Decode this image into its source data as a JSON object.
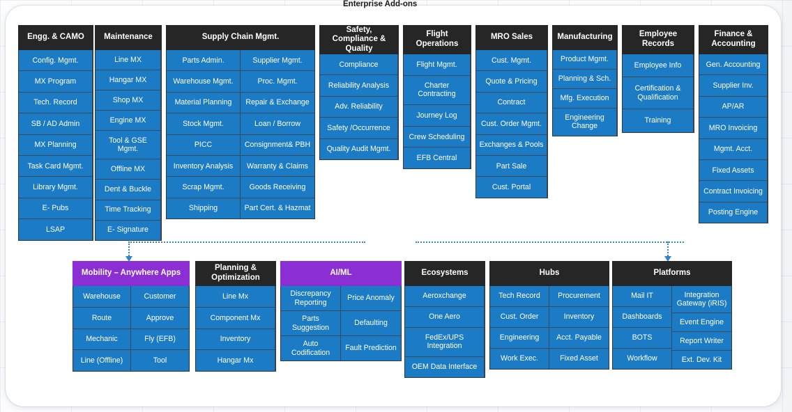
{
  "diagram": {
    "addons_label": "Enterprise Add-ons",
    "colors": {
      "tile_blue": "#1B7BC4",
      "header_dark": "#262626",
      "header_purple": "#8B2FD4",
      "connector_blue": "#2E86C8"
    }
  },
  "top_modules": [
    {
      "title": "Engg. & CAMO",
      "header_style": "dark",
      "columns": [
        [
          "Config. Mgmt.",
          "MX Program",
          "Tech. Record",
          "SB / AD Admin",
          "MX Planning",
          "Task Card Mgmt.",
          "Library Mgmt.",
          "E- Pubs",
          "LSAP"
        ]
      ]
    },
    {
      "title": "Maintenance",
      "header_style": "dark",
      "columns": [
        [
          "Line MX",
          "Hangar MX",
          "Shop MX",
          "Engine MX",
          "Tool & GSE Mgmt.",
          "Offline MX",
          "Dent & Buckle",
          "Time Tracking",
          "E- Signature"
        ]
      ]
    },
    {
      "title": "Supply Chain Mgmt.",
      "header_style": "dark",
      "columns": [
        [
          "Parts Admin.",
          "Warehouse Mgmt.",
          "Material Planning",
          "Stock Mgmt.",
          "PICC",
          "Inventory Analysis",
          "Scrap Mgmt.",
          "Shipping"
        ],
        [
          "Supplier Mgmt.",
          "Proc. Mgmt.",
          "Repair & Exchange",
          "Loan / Borrow",
          "Consignment& PBH",
          "Warranty & Claims",
          "Goods Receiving",
          "Part Cert. & Hazmat"
        ]
      ]
    },
    {
      "title": "Safety, Compliance & Quality",
      "header_style": "dark",
      "columns": [
        [
          "Compliance",
          "Reliability Analysis",
          "Adv. Reliability",
          "Safety /Occurrence",
          "Quality Audit Mgmt."
        ]
      ]
    },
    {
      "title": "Flight Operations",
      "header_style": "dark",
      "columns": [
        [
          "Flight Mgmt.",
          "Charter Contracting",
          "Journey Log",
          "Crew Scheduling",
          "EFB Central"
        ]
      ]
    },
    {
      "title": "MRO Sales",
      "header_style": "dark",
      "columns": [
        [
          "Cust. Mgmt.",
          "Quote & Pricing",
          "Contract",
          "Cust. Order Mgmt.",
          "Exchanges & Pools",
          "Part Sale",
          "Cust. Portal"
        ]
      ]
    },
    {
      "title": "Manufacturing",
      "header_style": "dark",
      "columns": [
        [
          "Product Mgmt.",
          "Planning & Sch.",
          "Mfg. Execution",
          "Engineering Change"
        ]
      ]
    },
    {
      "title": "Employee Records",
      "header_style": "dark",
      "columns": [
        [
          "Employee Info",
          "Certification & Qualification",
          "Training"
        ]
      ]
    },
    {
      "title": "Finance & Accounting",
      "header_style": "dark",
      "columns": [
        [
          "Gen. Accounting",
          "Supplier Inv.",
          "AP/AR",
          "MRO Invoicing",
          "Mgmt. Acct.",
          "Fixed Assets",
          "Contract Invoicing",
          "Posting Engine"
        ]
      ]
    }
  ],
  "addon_modules": [
    {
      "title": "Mobility – Anywhere Apps",
      "header_style": "purple",
      "columns": [
        [
          "Warehouse",
          "Route",
          "Mechanic",
          "Line (Offline)"
        ],
        [
          "Customer",
          "Approve",
          "Fly (EFB)",
          "Tool"
        ]
      ]
    },
    {
      "title": "Planning & Optimization",
      "header_style": "dark",
      "columns": [
        [
          "Line Mx",
          "Component Mx",
          "Inventory",
          "Hangar Mx"
        ]
      ]
    },
    {
      "title": "AI/ML",
      "header_style": "purple",
      "columns": [
        [
          "Discrepancy Reporting",
          "Parts Suggestion",
          "Auto Codification"
        ],
        [
          "Price Anomaly",
          "Defaulting",
          "Fault Prediction"
        ]
      ]
    },
    {
      "title": "Ecosystems",
      "header_style": "dark",
      "columns": [
        [
          "Aeroxchange",
          "One Aero",
          "FedEx/UPS Integration",
          "OEM Data Interface"
        ]
      ]
    },
    {
      "title": "Hubs",
      "header_style": "dark",
      "columns": [
        [
          "Tech Record",
          "Cust. Order",
          "Engineering",
          "Work Exec."
        ],
        [
          "Procurement",
          "Inventory",
          "Acct. Payable",
          "Fixed Asset"
        ]
      ]
    },
    {
      "title": "Platforms",
      "header_style": "dark",
      "columns": [
        [
          "Mail IT",
          "Dashboards",
          "BOTS",
          "Workflow"
        ],
        [
          "Integration Gateway (iRIS)",
          "Event Engine",
          "Report Writer",
          "Ext. Dev. Kit"
        ]
      ]
    }
  ]
}
